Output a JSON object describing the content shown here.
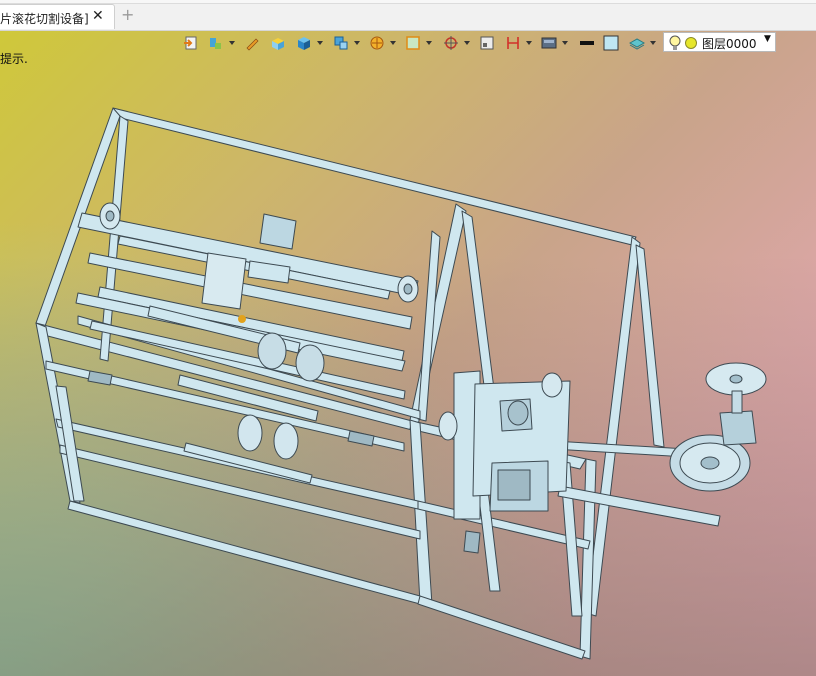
{
  "tab": {
    "title": "片滚花切割设备]",
    "close": "✕",
    "add": "+"
  },
  "viewport": {
    "hint": "提示."
  },
  "toolbar": {
    "items": [
      "import-icon",
      "paint-icon",
      "pen-icon",
      "box-icon",
      "cube-icon",
      "cube-stack-icon",
      "render-icon",
      "view-frame-icon",
      "snap-icon",
      "viewport-icon",
      "dimension-icon",
      "display-icon",
      "black-box",
      "light-box",
      "layer-plane-icon"
    ]
  },
  "layer": {
    "name": "图层0000"
  },
  "colors": {
    "frame": "#cfe7ef",
    "frame_edge": "#3d4a52",
    "bg_top_left": "#cfc83a",
    "bg_top_right": "#f0a7bb",
    "bg_bottom_left": "#9ad8ad"
  }
}
